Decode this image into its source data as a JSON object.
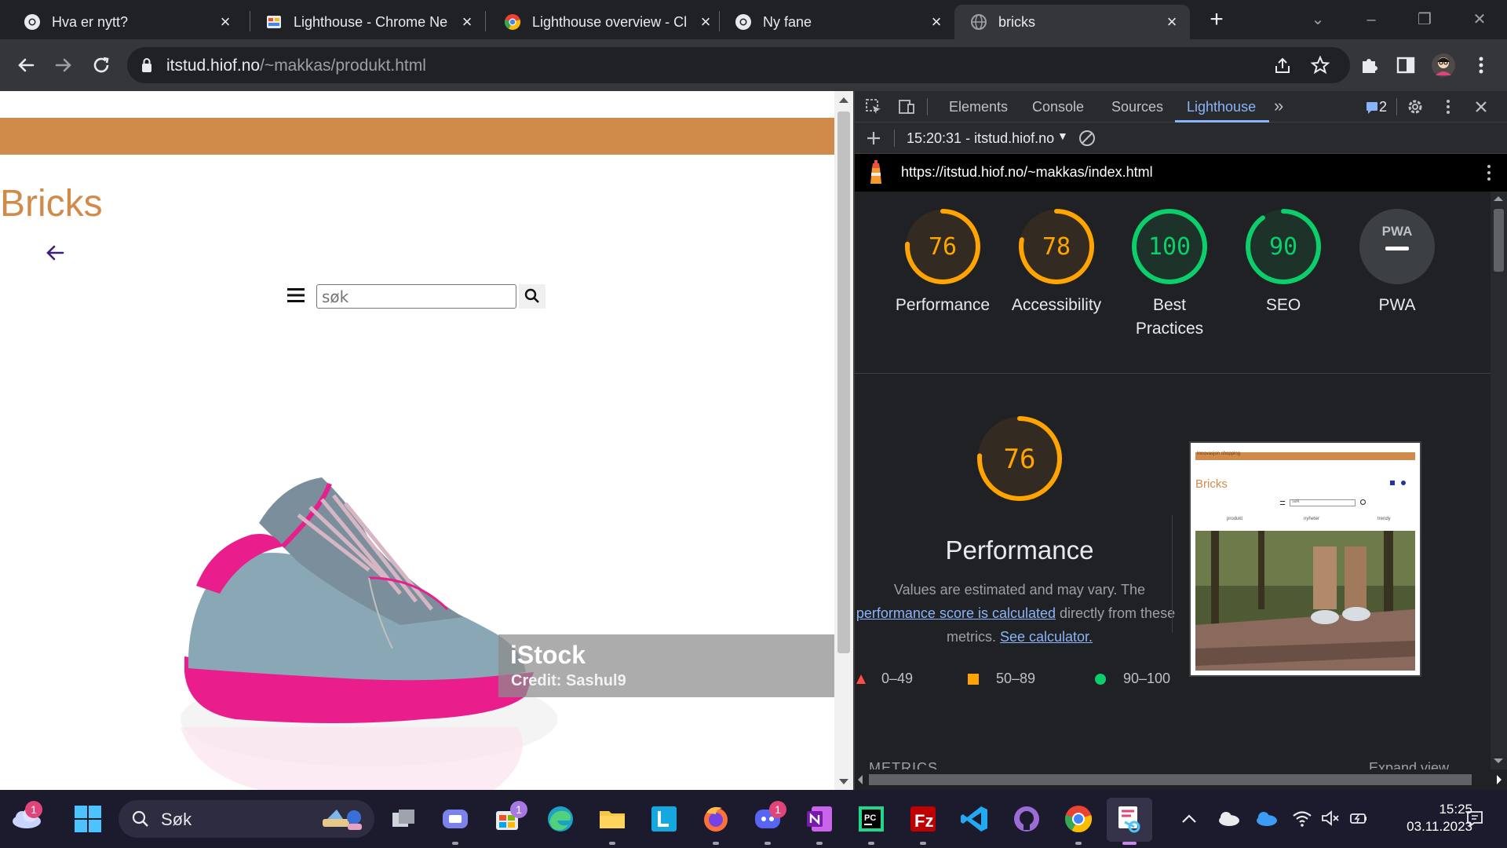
{
  "browser": {
    "tabs": [
      {
        "title": "Hva er nytt?",
        "active": false
      },
      {
        "title": "Lighthouse - Chrome Ne",
        "active": false
      },
      {
        "title": "Lighthouse overview - Cl",
        "active": false
      },
      {
        "title": "Ny fane",
        "active": false
      },
      {
        "title": "bricks",
        "active": true
      }
    ],
    "url_host": "itstud.hiof.no",
    "url_path": "/~makkas/produkt.html"
  },
  "page": {
    "title": "Bricks",
    "search_placeholder": "søk",
    "image_watermark": "iStock",
    "image_credit": "Credit: Sashul9"
  },
  "devtools": {
    "tabs": [
      "Elements",
      "Console",
      "Sources",
      "Lighthouse"
    ],
    "active_tab": "Lighthouse",
    "issues_count": "2",
    "report_selector": "15:20:31 - itstud.hiof.no",
    "report_url": "https://itstud.hiof.no/~makkas/index.html",
    "scores": [
      {
        "label": "Performance",
        "value": "76",
        "score": 76,
        "color": "#ffa400"
      },
      {
        "label": "Accessibility",
        "value": "78",
        "score": 78,
        "color": "#ffa400"
      },
      {
        "label": "Best Practices",
        "value": "100",
        "score": 100,
        "color": "#0cce6b"
      },
      {
        "label": "SEO",
        "value": "90",
        "score": 90,
        "color": "#0cce6b"
      },
      {
        "label": "PWA",
        "value": "PWA",
        "score": null,
        "color": "#9aa0a6"
      }
    ],
    "performance": {
      "score": "76",
      "title": "Performance",
      "desc_1": "Values are estimated and may vary. The",
      "desc_link_1": "performance score is calculated",
      "desc_2": "directly from these",
      "desc_3": "metrics.",
      "desc_link_2": "See calculator."
    },
    "legend": [
      {
        "label": "0–49",
        "color": "#ff4e42",
        "shape": "triangle"
      },
      {
        "label": "50–89",
        "color": "#ffa400",
        "shape": "square"
      },
      {
        "label": "90–100",
        "color": "#0cce6b",
        "shape": "circle"
      }
    ],
    "metrics_label": "METRICS",
    "expand_label": "Expand view",
    "thumbnail": {
      "site_title": "Bricks",
      "menu_items": [
        "produkt",
        "nyheter",
        "trendy"
      ],
      "search_placeholder": "søk",
      "banner_text": "Innovasjon shopping"
    }
  },
  "taskbar": {
    "search_label": "Søk",
    "time": "15:25",
    "date": "03.11.2023",
    "weather_badge": "1",
    "store_badge": "1",
    "discord_badge": "1"
  },
  "colors": {
    "accent_orange": "#d08b4a",
    "devtools_blue": "#8ab4f8"
  }
}
